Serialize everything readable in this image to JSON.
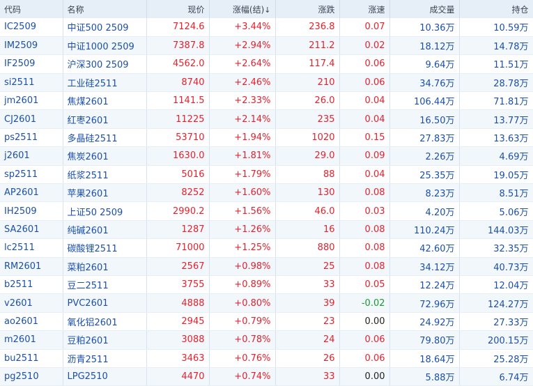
{
  "header": {
    "code": "代码",
    "name": "名称",
    "price": "现价",
    "pct": "涨幅(结)",
    "chg": "涨跌",
    "speed": "涨速",
    "vol": "成交量",
    "oi": "持仓"
  },
  "rows": [
    {
      "code": "IC2509",
      "name": "中证500 2509",
      "price": "7124.6",
      "pct": "+3.44%",
      "chg": "236.8",
      "speed": "0.07",
      "vol": "10.36万",
      "oi": "10.59万"
    },
    {
      "code": "IM2509",
      "name": "中证1000 2509",
      "price": "7387.8",
      "pct": "+2.94%",
      "chg": "211.2",
      "speed": "0.02",
      "vol": "18.12万",
      "oi": "14.78万"
    },
    {
      "code": "IF2509",
      "name": "沪深300 2509",
      "price": "4562.0",
      "pct": "+2.64%",
      "chg": "117.4",
      "speed": "0.06",
      "vol": "9.64万",
      "oi": "11.51万"
    },
    {
      "code": "si2511",
      "name": "工业硅2511",
      "price": "8740",
      "pct": "+2.46%",
      "chg": "210",
      "speed": "0.06",
      "vol": "34.76万",
      "oi": "28.78万"
    },
    {
      "code": "jm2601",
      "name": "焦煤2601",
      "price": "1141.5",
      "pct": "+2.33%",
      "chg": "26.0",
      "speed": "0.04",
      "vol": "106.44万",
      "oi": "71.81万"
    },
    {
      "code": "CJ2601",
      "name": "红枣2601",
      "price": "11225",
      "pct": "+2.14%",
      "chg": "235",
      "speed": "0.04",
      "vol": "16.50万",
      "oi": "13.77万"
    },
    {
      "code": "ps2511",
      "name": "多晶硅2511",
      "price": "53710",
      "pct": "+1.94%",
      "chg": "1020",
      "speed": "0.15",
      "vol": "27.83万",
      "oi": "13.63万"
    },
    {
      "code": "j2601",
      "name": "焦炭2601",
      "price": "1630.0",
      "pct": "+1.81%",
      "chg": "29.0",
      "speed": "0.09",
      "vol": "2.26万",
      "oi": "4.69万"
    },
    {
      "code": "sp2511",
      "name": "纸浆2511",
      "price": "5016",
      "pct": "+1.79%",
      "chg": "88",
      "speed": "0.04",
      "vol": "25.35万",
      "oi": "19.05万"
    },
    {
      "code": "AP2601",
      "name": "苹果2601",
      "price": "8252",
      "pct": "+1.60%",
      "chg": "130",
      "speed": "0.08",
      "vol": "8.23万",
      "oi": "8.51万"
    },
    {
      "code": "IH2509",
      "name": "上证50 2509",
      "price": "2990.2",
      "pct": "+1.56%",
      "chg": "46.0",
      "speed": "0.03",
      "vol": "4.20万",
      "oi": "5.06万"
    },
    {
      "code": "SA2601",
      "name": "纯碱2601",
      "price": "1287",
      "pct": "+1.26%",
      "chg": "16",
      "speed": "0.08",
      "vol": "110.24万",
      "oi": "144.03万"
    },
    {
      "code": "lc2511",
      "name": "碳酸锂2511",
      "price": "71000",
      "pct": "+1.25%",
      "chg": "880",
      "speed": "0.08",
      "vol": "42.60万",
      "oi": "32.35万"
    },
    {
      "code": "RM2601",
      "name": "菜粕2601",
      "price": "2567",
      "pct": "+0.98%",
      "chg": "25",
      "speed": "0.08",
      "vol": "34.12万",
      "oi": "40.73万"
    },
    {
      "code": "b2511",
      "name": "豆二2511",
      "price": "3755",
      "pct": "+0.89%",
      "chg": "33",
      "speed": "0.05",
      "vol": "12.24万",
      "oi": "12.04万"
    },
    {
      "code": "v2601",
      "name": "PVC2601",
      "price": "4888",
      "pct": "+0.80%",
      "chg": "39",
      "speed": "-0.02",
      "vol": "72.96万",
      "oi": "124.27万"
    },
    {
      "code": "ao2601",
      "name": "氧化铝2601",
      "price": "2945",
      "pct": "+0.79%",
      "chg": "23",
      "speed": "0.00",
      "vol": "24.92万",
      "oi": "27.33万"
    },
    {
      "code": "m2601",
      "name": "豆粕2601",
      "price": "3088",
      "pct": "+0.78%",
      "chg": "24",
      "speed": "0.06",
      "vol": "79.80万",
      "oi": "200.15万"
    },
    {
      "code": "bu2511",
      "name": "沥青2511",
      "price": "3463",
      "pct": "+0.76%",
      "chg": "26",
      "speed": "0.06",
      "vol": "18.64万",
      "oi": "25.28万"
    },
    {
      "code": "pg2510",
      "name": "LPG2510",
      "price": "4470",
      "pct": "+0.74%",
      "chg": "33",
      "speed": "0.00",
      "vol": "5.88万",
      "oi": "6.74万"
    }
  ]
}
